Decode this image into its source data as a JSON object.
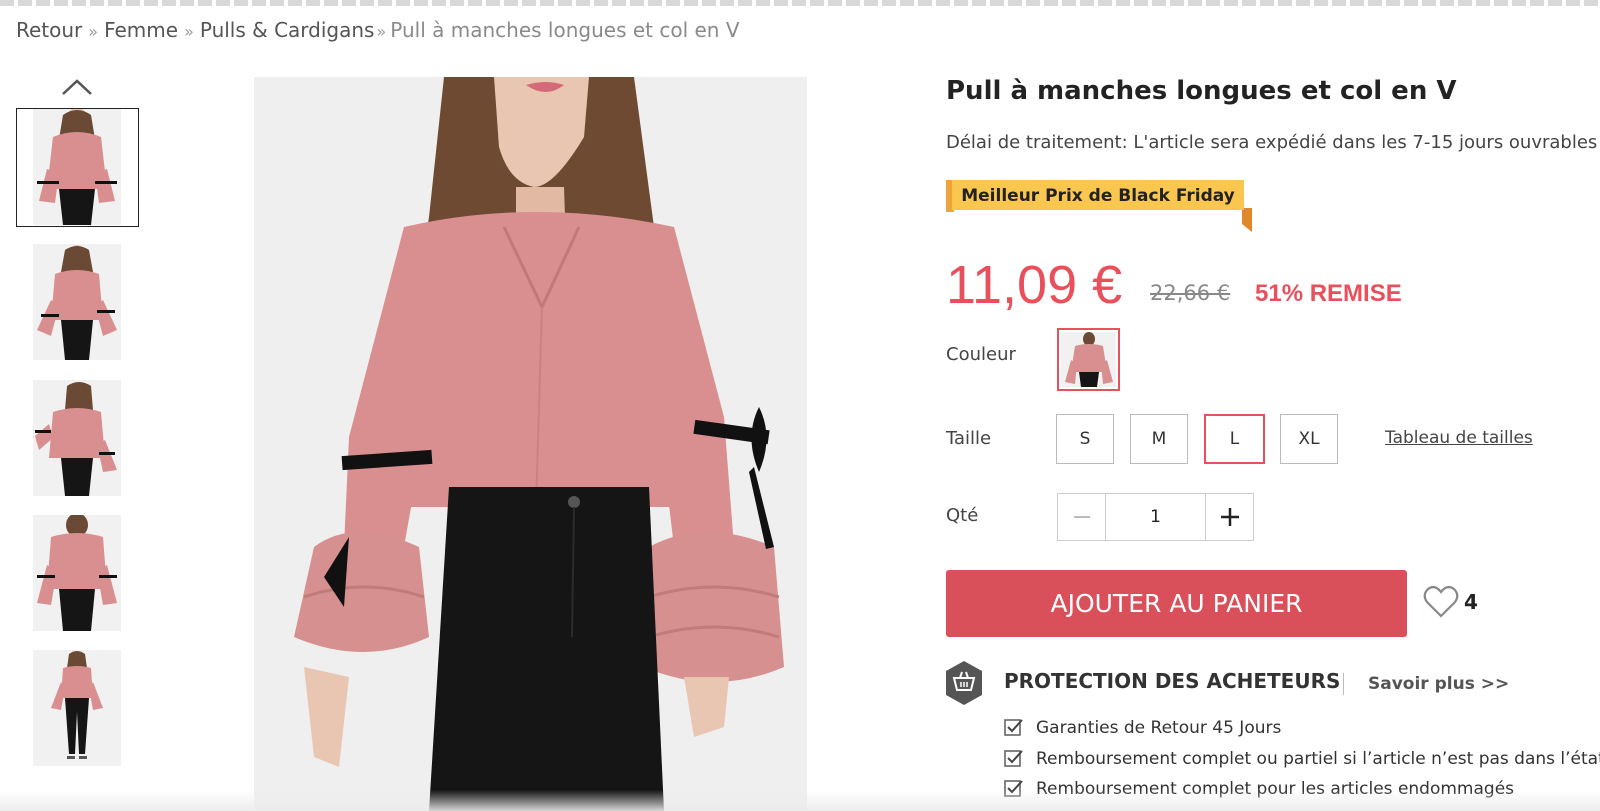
{
  "breadcrumb": {
    "items": [
      "Retour",
      "Femme",
      "Pulls & Cardigans"
    ],
    "separator": "»",
    "current": "Pull à manches longues et col en V"
  },
  "gallery": {
    "thumbnails": [
      {
        "name": "thumbnail-front-view",
        "active": true
      },
      {
        "name": "thumbnail-front-open"
      },
      {
        "name": "thumbnail-side-view"
      },
      {
        "name": "thumbnail-back-view"
      },
      {
        "name": "thumbnail-full-length"
      }
    ],
    "scroll_up_icon": "chevron-up-icon",
    "main_image_icon": "product-photo"
  },
  "product": {
    "title": "Pull à manches longues et col en V",
    "processing_time": "Délai de traitement: L'article sera expédié dans les 7-15 jours ouvrables",
    "promo_badge": "Meilleur Prix de Black Friday",
    "price": "11,09 €",
    "old_price": "22,66 €",
    "discount": "51% REMISE",
    "color_label": "Couleur",
    "size_label": "Taille",
    "sizes": [
      "S",
      "M",
      "L",
      "XL"
    ],
    "selected_size": "L",
    "size_chart": "Tableau de tailles",
    "qty_label": "Qté",
    "qty_value": "1",
    "add_to_cart": "AJOUTER AU PANIER",
    "wishlist_count": "4"
  },
  "protection": {
    "title": "PROTECTION DES ACHETEURS",
    "learn_more": "Savoir plus >>",
    "items": [
      "Garanties de Retour 45 Jours",
      "Remboursement complet ou partiel si l’article n’est pas dans l’état décrit",
      "Remboursement complet pour les articles endommagés"
    ]
  },
  "colors": {
    "accent": "#e8505b",
    "cart_button": "#d9505a",
    "ribbon": "#f9c74f",
    "sweater_pink": "#d98f8f"
  }
}
